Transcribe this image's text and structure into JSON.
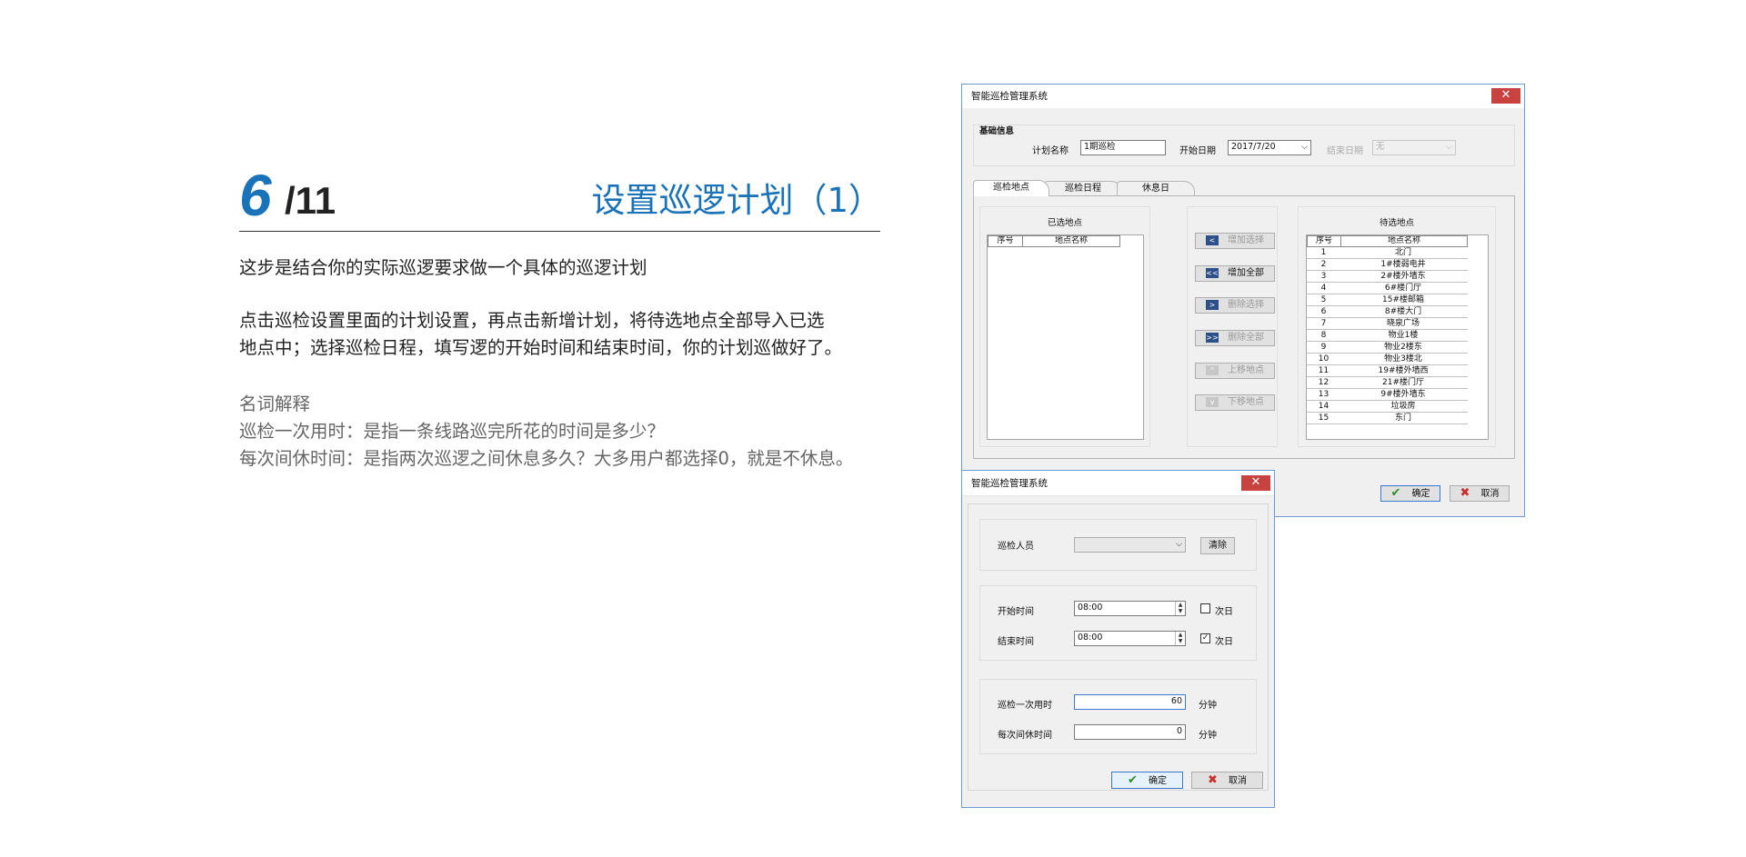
{
  "slide": {
    "page_number": "6",
    "page_total": "/11",
    "title": "设置巡逻计划（1）",
    "intro": "这步是结合你的实际巡逻要求做一个具体的巡逻计划",
    "step_line1": "点击巡检设置里面的计划设置，再点击新增计划，将待选地点全部导入已选",
    "step_line2": "地点中；选择巡检日程，填写逻的开始时间和结束时间，你的计划巡做好了。",
    "glossary_title": "名词解释",
    "glossary_1": "巡检一次用时：是指一条线路巡完所花的时间是多少？",
    "glossary_2": "每次间休时间：是指两次巡逻之间休息多久？大多用户都选择0，就是不休息。"
  },
  "win_main": {
    "title": "智能巡检管理系统",
    "close": "✕",
    "basic_info": "基础信息",
    "plan_name_label": "计划名称",
    "plan_name_value": "1期巡检",
    "start_date_label": "开始日期",
    "start_date_value": "2017/7/20",
    "end_date_label": "结束日期",
    "end_date_value": "无",
    "tabs": [
      "巡检地点",
      "巡检日程",
      "休息日"
    ],
    "selected_title": "已选地点",
    "candidate_title": "待选地点",
    "col_no": "序号",
    "col_name": "地点名称",
    "buttons": {
      "add_selected": "增加选择",
      "add_all": "增加全部",
      "remove_selected": "删除选择",
      "remove_all": "删除全部",
      "move_up": "上移地点",
      "move_down": "下移地点"
    },
    "arrow_glyphs": {
      "left": "<",
      "left_all": "<<",
      "right": ">",
      "right_all": ">>",
      "up": "^",
      "down": "v"
    },
    "candidates": [
      {
        "no": "1",
        "name": "北门"
      },
      {
        "no": "2",
        "name": "1#楼弱电井"
      },
      {
        "no": "3",
        "name": "2#楼外墙东"
      },
      {
        "no": "4",
        "name": "6#楼门厅"
      },
      {
        "no": "5",
        "name": "15#楼邮箱"
      },
      {
        "no": "6",
        "name": "8#楼大门"
      },
      {
        "no": "7",
        "name": "晓泉广场"
      },
      {
        "no": "8",
        "name": "物业1楼"
      },
      {
        "no": "9",
        "name": "物业2楼东"
      },
      {
        "no": "10",
        "name": "物业3楼北"
      },
      {
        "no": "11",
        "name": "19#楼外墙西"
      },
      {
        "no": "12",
        "name": "21#楼门厅"
      },
      {
        "no": "13",
        "name": "9#楼外墙东"
      },
      {
        "no": "14",
        "name": "垃圾房"
      },
      {
        "no": "15",
        "name": "东门"
      }
    ],
    "ok": "确定",
    "cancel": "取消"
  },
  "win_sched": {
    "title": "智能巡检管理系统",
    "close": "✕",
    "inspector_label": "巡检人员",
    "inspector_value": "",
    "clear_button": "清除",
    "start_time_label": "开始时间",
    "start_time_value": "08:00",
    "start_next_day_label": "次日",
    "start_next_day_checked": false,
    "end_time_label": "结束时间",
    "end_time_value": "08:00",
    "end_next_day_label": "次日",
    "end_next_day_checked": true,
    "duration_label": "巡检一次用时",
    "duration_value": "60",
    "duration_unit": "分钟",
    "rest_label": "每次间休时间",
    "rest_value": "0",
    "rest_unit": "分钟",
    "ok": "确定",
    "cancel": "取消",
    "check_mark": "✓",
    "ok_icon": "✔",
    "cancel_icon": "✖",
    "spin_up": "▲",
    "spin_down": "▼",
    "dropdown": "⌵"
  },
  "colors": {
    "accent": "#1a73b8",
    "close_red": "#c8423f",
    "window_border": "#6b9bd2"
  }
}
